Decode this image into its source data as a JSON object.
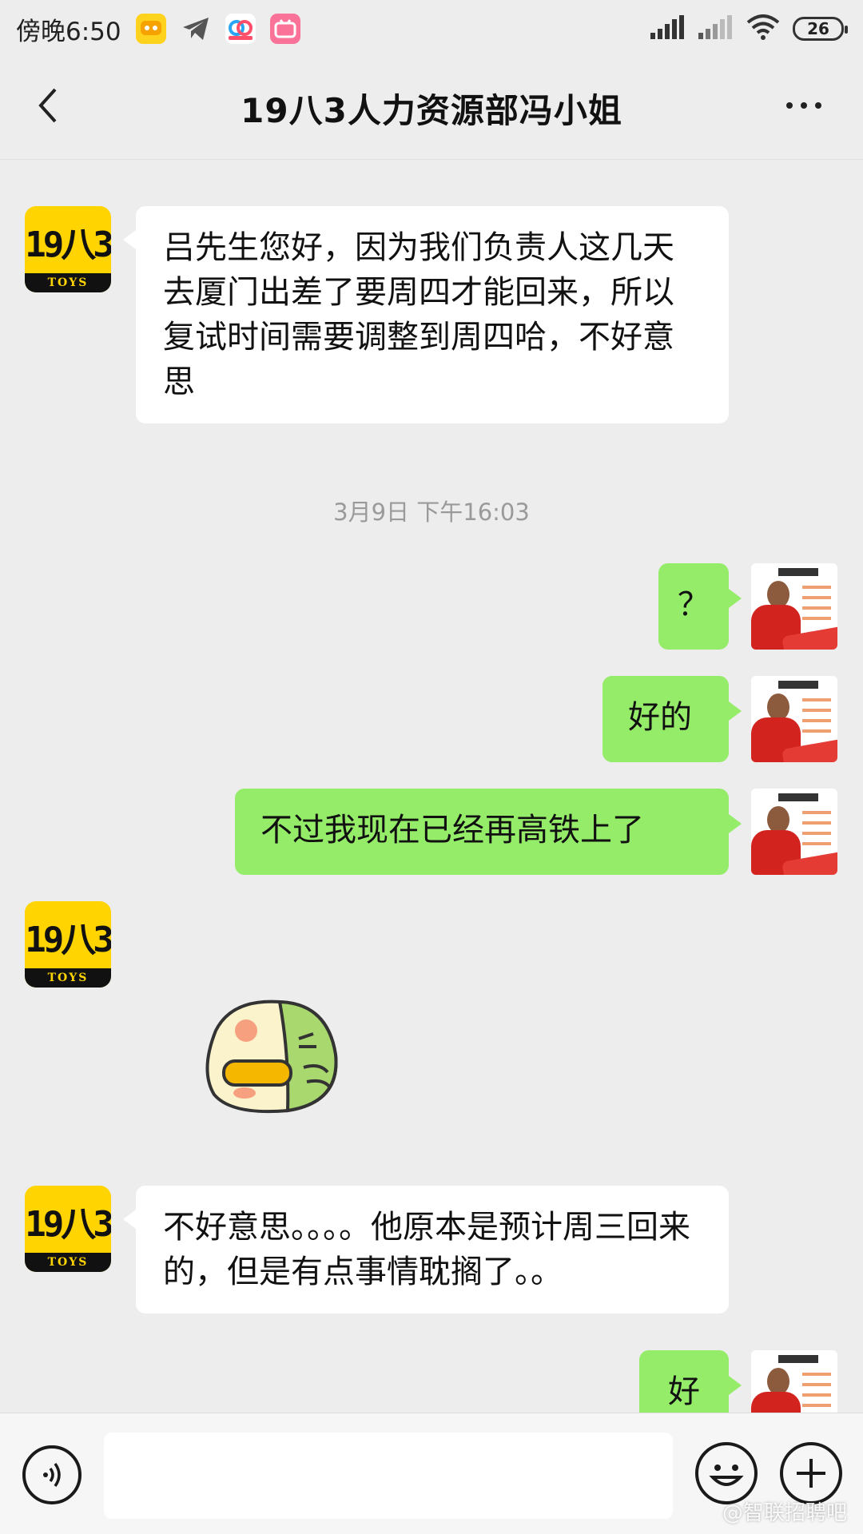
{
  "status_bar": {
    "time": "傍晚6:50",
    "battery": "26",
    "app_icons": [
      "game-center-icon",
      "telegram-icon",
      "baidu-netdisk-icon",
      "bilibili-icon"
    ]
  },
  "header": {
    "title": "19八3人力资源部冯小姐"
  },
  "messages": [
    {
      "side": "left",
      "text": "吕先生您好，因为我们负责人这几天去厦门出差了要周四才能回来，所以复试时间需要调整到周四哈，不好意思"
    },
    {
      "type": "timestamp",
      "text": "3月9日 下午16:03"
    },
    {
      "side": "right",
      "text": "？"
    },
    {
      "side": "right",
      "text": "好的"
    },
    {
      "side": "right",
      "text": "不过我现在已经再高铁上了"
    },
    {
      "side": "left",
      "type": "sticker",
      "sticker": "green-bird-sticker"
    },
    {
      "side": "left",
      "text": "不好意思。。。。他原本是预计周三回来的，但是有点事情耽搁了。。"
    },
    {
      "side": "right",
      "text": "好"
    }
  ],
  "avatars": {
    "left_logo_mark": "19八3",
    "left_logo_band": "TOYS"
  },
  "input_bar": {
    "value": "",
    "watermark": "@智联招聘吧"
  },
  "colors": {
    "background": "#ededed",
    "bubble_self": "#95ec69",
    "bubble_other": "#ffffff",
    "brand_yellow": "#ffd400"
  }
}
